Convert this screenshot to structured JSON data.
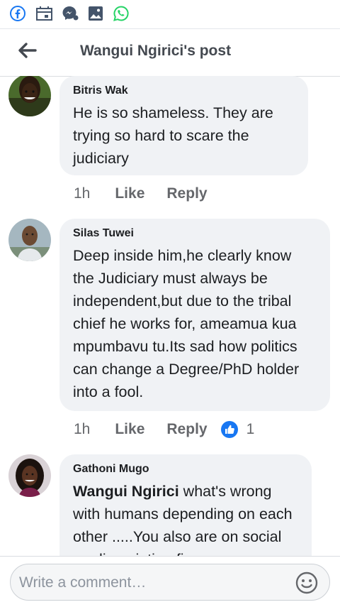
{
  "header": {
    "title": "Wangui Ngirici's post"
  },
  "comments": [
    {
      "author": "Bitris Wak",
      "text": "He is so shameless. They are trying so hard to scare the judiciary",
      "time": "1h",
      "like": "Like",
      "reply": "Reply"
    },
    {
      "author": "Silas Tuwei",
      "text": "Deep inside him,he clearly know the Judiciary must always be independent,but due to the tribal chief he works for, ameamua kua mpumbavu tu.Its sad how politics can change a Degree/PhD holder into a fool.",
      "time": "1h",
      "like": "Like",
      "reply": "Reply",
      "reactions": "1"
    },
    {
      "author": "Gathoni Mugo",
      "mention": "Wangui Ngirici",
      "text": " what's wrong with humans depending on each other .....You also are on social media pointing fingers"
    }
  ],
  "composer": {
    "placeholder": "Write a comment…"
  },
  "icons": [
    "facebook-icon",
    "calendar-icon",
    "messenger-icon",
    "gallery-icon",
    "whatsapp-icon",
    "back-arrow-icon",
    "like-reaction-icon",
    "emoji-icon"
  ],
  "colors": {
    "brand": "#1877f2",
    "whatsapp": "#25d366",
    "bubble": "#f0f2f5",
    "meta": "#65676b"
  }
}
